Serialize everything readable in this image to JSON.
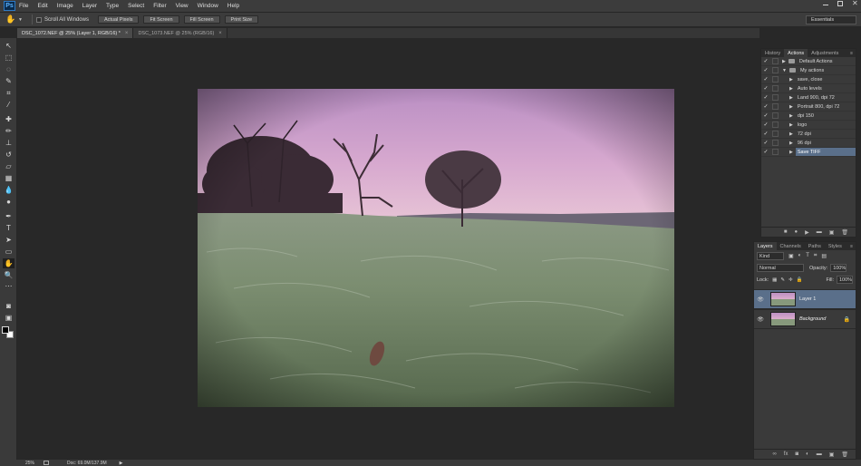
{
  "app": {
    "logo": "Ps"
  },
  "menu": [
    "File",
    "Edit",
    "Image",
    "Layer",
    "Type",
    "Select",
    "Filter",
    "View",
    "Window",
    "Help"
  ],
  "options": {
    "scroll_all_windows": "Scroll All Windows",
    "buttons": [
      "Actual Pixels",
      "Fit Screen",
      "Fill Screen",
      "Print Size"
    ],
    "workspace": "Essentials"
  },
  "tabs": [
    {
      "label": "DSC_1072.NEF @ 25% (Layer 1, RGB/16) *",
      "active": true
    },
    {
      "label": "DSC_1073.NEF @ 25% (RGB/16)",
      "active": false
    }
  ],
  "status": {
    "zoom": "25%",
    "doc": "Doc: 69.0M/137.9M"
  },
  "actions_panel": {
    "tabs": [
      "History",
      "Actions",
      "Adjustments"
    ],
    "active_tab": "Actions",
    "rows": [
      {
        "name": "Default Actions",
        "type": "set",
        "expanded": false
      },
      {
        "name": "My actions",
        "type": "set",
        "expanded": true
      },
      {
        "name": "save, close",
        "type": "action"
      },
      {
        "name": "Auto levels",
        "type": "action"
      },
      {
        "name": "Land 900, dpi 72",
        "type": "action"
      },
      {
        "name": "Portrait 800, dpi 72",
        "type": "action"
      },
      {
        "name": "dpi 150",
        "type": "action"
      },
      {
        "name": "logo",
        "type": "action"
      },
      {
        "name": "72 dpi",
        "type": "action"
      },
      {
        "name": "96 dpi",
        "type": "action"
      },
      {
        "name": "Save TIFF",
        "type": "action",
        "highlighted": true
      }
    ]
  },
  "layers_panel": {
    "tabs": [
      "Layers",
      "Channels",
      "Paths",
      "Styles"
    ],
    "active_tab": "Layers",
    "kind": "Kind",
    "blend_mode": "Normal",
    "opacity_label": "Opacity:",
    "opacity": "100%",
    "lock_label": "Lock:",
    "fill_label": "Fill:",
    "fill": "100%",
    "layers": [
      {
        "name": "Layer 1",
        "active": true,
        "locked": false
      },
      {
        "name": "Background",
        "active": false,
        "locked": true
      }
    ]
  },
  "colors": {
    "ui_dark": "#282828",
    "panel": "#3a3a3a",
    "selection": "#5a6f8a"
  }
}
